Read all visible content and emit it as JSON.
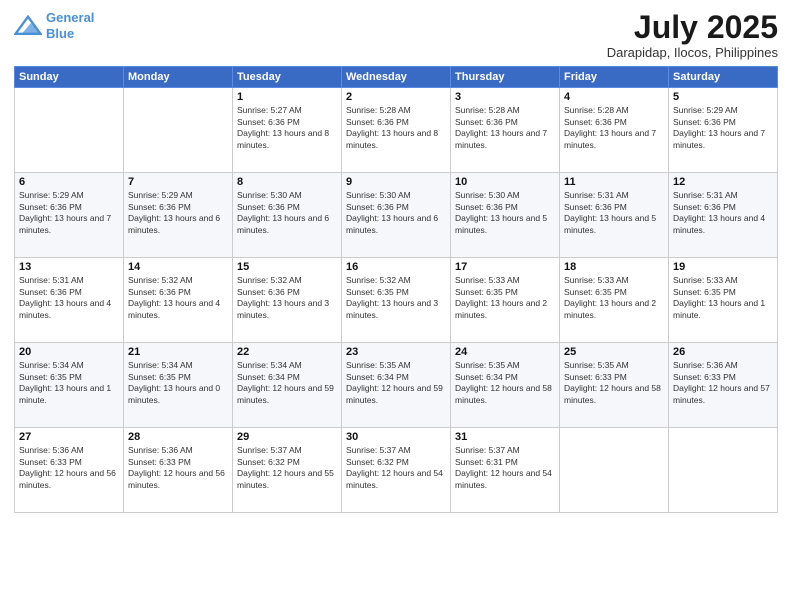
{
  "logo": {
    "line1": "General",
    "line2": "Blue"
  },
  "title": "July 2025",
  "subtitle": "Darapidap, Ilocos, Philippines",
  "weekdays": [
    "Sunday",
    "Monday",
    "Tuesday",
    "Wednesday",
    "Thursday",
    "Friday",
    "Saturday"
  ],
  "weeks": [
    [
      {
        "day": "",
        "info": ""
      },
      {
        "day": "",
        "info": ""
      },
      {
        "day": "1",
        "info": "Sunrise: 5:27 AM\nSunset: 6:36 PM\nDaylight: 13 hours and 8 minutes."
      },
      {
        "day": "2",
        "info": "Sunrise: 5:28 AM\nSunset: 6:36 PM\nDaylight: 13 hours and 8 minutes."
      },
      {
        "day": "3",
        "info": "Sunrise: 5:28 AM\nSunset: 6:36 PM\nDaylight: 13 hours and 7 minutes."
      },
      {
        "day": "4",
        "info": "Sunrise: 5:28 AM\nSunset: 6:36 PM\nDaylight: 13 hours and 7 minutes."
      },
      {
        "day": "5",
        "info": "Sunrise: 5:29 AM\nSunset: 6:36 PM\nDaylight: 13 hours and 7 minutes."
      }
    ],
    [
      {
        "day": "6",
        "info": "Sunrise: 5:29 AM\nSunset: 6:36 PM\nDaylight: 13 hours and 7 minutes."
      },
      {
        "day": "7",
        "info": "Sunrise: 5:29 AM\nSunset: 6:36 PM\nDaylight: 13 hours and 6 minutes."
      },
      {
        "day": "8",
        "info": "Sunrise: 5:30 AM\nSunset: 6:36 PM\nDaylight: 13 hours and 6 minutes."
      },
      {
        "day": "9",
        "info": "Sunrise: 5:30 AM\nSunset: 6:36 PM\nDaylight: 13 hours and 6 minutes."
      },
      {
        "day": "10",
        "info": "Sunrise: 5:30 AM\nSunset: 6:36 PM\nDaylight: 13 hours and 5 minutes."
      },
      {
        "day": "11",
        "info": "Sunrise: 5:31 AM\nSunset: 6:36 PM\nDaylight: 13 hours and 5 minutes."
      },
      {
        "day": "12",
        "info": "Sunrise: 5:31 AM\nSunset: 6:36 PM\nDaylight: 13 hours and 4 minutes."
      }
    ],
    [
      {
        "day": "13",
        "info": "Sunrise: 5:31 AM\nSunset: 6:36 PM\nDaylight: 13 hours and 4 minutes."
      },
      {
        "day": "14",
        "info": "Sunrise: 5:32 AM\nSunset: 6:36 PM\nDaylight: 13 hours and 4 minutes."
      },
      {
        "day": "15",
        "info": "Sunrise: 5:32 AM\nSunset: 6:36 PM\nDaylight: 13 hours and 3 minutes."
      },
      {
        "day": "16",
        "info": "Sunrise: 5:32 AM\nSunset: 6:35 PM\nDaylight: 13 hours and 3 minutes."
      },
      {
        "day": "17",
        "info": "Sunrise: 5:33 AM\nSunset: 6:35 PM\nDaylight: 13 hours and 2 minutes."
      },
      {
        "day": "18",
        "info": "Sunrise: 5:33 AM\nSunset: 6:35 PM\nDaylight: 13 hours and 2 minutes."
      },
      {
        "day": "19",
        "info": "Sunrise: 5:33 AM\nSunset: 6:35 PM\nDaylight: 13 hours and 1 minute."
      }
    ],
    [
      {
        "day": "20",
        "info": "Sunrise: 5:34 AM\nSunset: 6:35 PM\nDaylight: 13 hours and 1 minute."
      },
      {
        "day": "21",
        "info": "Sunrise: 5:34 AM\nSunset: 6:35 PM\nDaylight: 13 hours and 0 minutes."
      },
      {
        "day": "22",
        "info": "Sunrise: 5:34 AM\nSunset: 6:34 PM\nDaylight: 12 hours and 59 minutes."
      },
      {
        "day": "23",
        "info": "Sunrise: 5:35 AM\nSunset: 6:34 PM\nDaylight: 12 hours and 59 minutes."
      },
      {
        "day": "24",
        "info": "Sunrise: 5:35 AM\nSunset: 6:34 PM\nDaylight: 12 hours and 58 minutes."
      },
      {
        "day": "25",
        "info": "Sunrise: 5:35 AM\nSunset: 6:33 PM\nDaylight: 12 hours and 58 minutes."
      },
      {
        "day": "26",
        "info": "Sunrise: 5:36 AM\nSunset: 6:33 PM\nDaylight: 12 hours and 57 minutes."
      }
    ],
    [
      {
        "day": "27",
        "info": "Sunrise: 5:36 AM\nSunset: 6:33 PM\nDaylight: 12 hours and 56 minutes."
      },
      {
        "day": "28",
        "info": "Sunrise: 5:36 AM\nSunset: 6:33 PM\nDaylight: 12 hours and 56 minutes."
      },
      {
        "day": "29",
        "info": "Sunrise: 5:37 AM\nSunset: 6:32 PM\nDaylight: 12 hours and 55 minutes."
      },
      {
        "day": "30",
        "info": "Sunrise: 5:37 AM\nSunset: 6:32 PM\nDaylight: 12 hours and 54 minutes."
      },
      {
        "day": "31",
        "info": "Sunrise: 5:37 AM\nSunset: 6:31 PM\nDaylight: 12 hours and 54 minutes."
      },
      {
        "day": "",
        "info": ""
      },
      {
        "day": "",
        "info": ""
      }
    ]
  ]
}
